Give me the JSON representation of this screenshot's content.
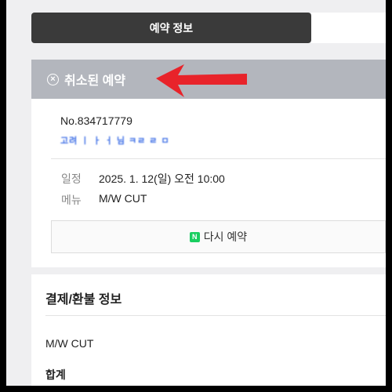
{
  "tabs": {
    "active_label": "예약 정보"
  },
  "status": {
    "label": "취소된 예약",
    "icon": "close-circle-icon"
  },
  "annotation": {
    "color": "#e8232a"
  },
  "reservation": {
    "order_no": "No.834717779",
    "customer_name_redacted": "고려 ㅣ ㅏ ㅓ 님 ㅋㄹ ㄹ  ㅁ",
    "schedule_label": "일정",
    "schedule_value": "2025. 1. 12(일) 오전 10:00",
    "menu_label": "메뉴",
    "menu_value": "M/W CUT",
    "rebook_label": "다시 예약",
    "rebook_icon": "naver-n-icon"
  },
  "payment": {
    "title": "결제/환불 정보",
    "item_name": "M/W CUT",
    "total_label": "합계"
  },
  "colors": {
    "status_bar": "#b3b6bd",
    "tab_active": "#3a3a3a",
    "naver_green": "#19ce60"
  }
}
